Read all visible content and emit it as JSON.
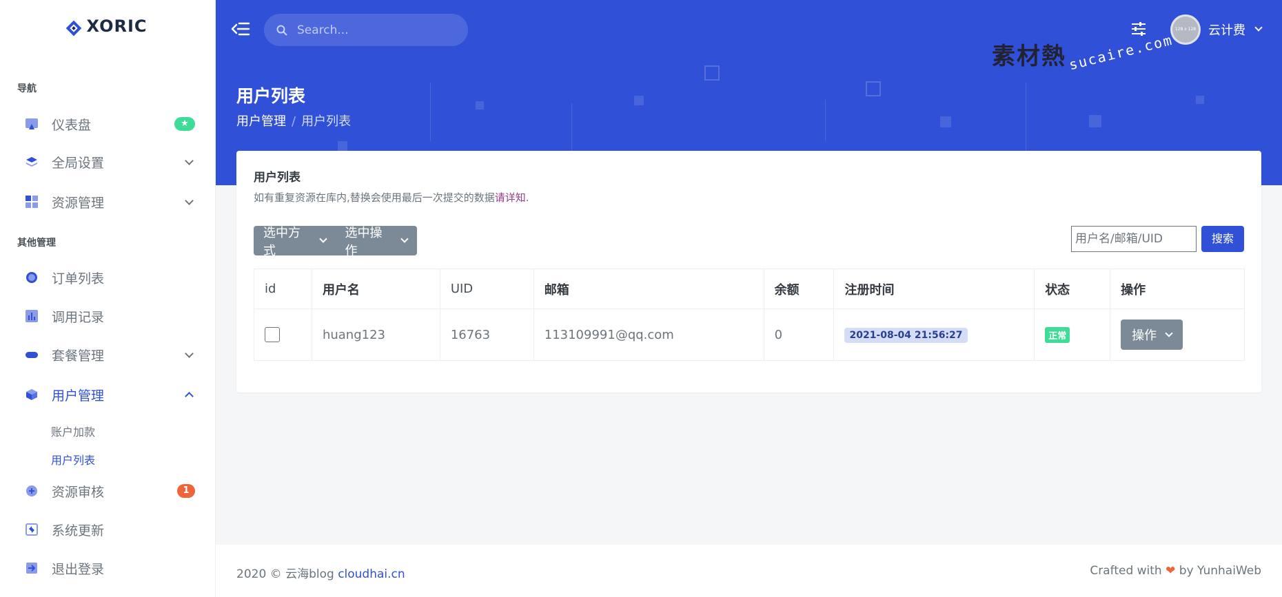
{
  "brand": {
    "name": "XORIC"
  },
  "sidebar": {
    "sections": [
      {
        "title": "导航"
      },
      {
        "title": "其他管理"
      }
    ],
    "items": [
      {
        "label": "仪表盘",
        "badge": "★"
      },
      {
        "label": "全局设置"
      },
      {
        "label": "资源管理"
      },
      {
        "label": "订单列表"
      },
      {
        "label": "调用记录"
      },
      {
        "label": "套餐管理"
      },
      {
        "label": "用户管理",
        "active": true
      },
      {
        "label": "资源审核",
        "badge": "1"
      },
      {
        "label": "系统更新"
      },
      {
        "label": "退出登录"
      }
    ],
    "sub_items": [
      {
        "label": "账户加款"
      },
      {
        "label": "用户列表",
        "active": true
      }
    ]
  },
  "header": {
    "search_placeholder": "Search...",
    "user_name": "云计费",
    "avatar_text": "128 x 128",
    "watermark_cn": "素材熱",
    "watermark_en": "sucaire.com",
    "page_title": "用户列表",
    "breadcrumb": [
      "用户管理",
      "用户列表"
    ],
    "breadcrumb_sep": "/"
  },
  "card": {
    "title": "用户列表",
    "desc": "如有重复资源在库内,替换会使用最后一次提交的数据",
    "desc_link": "请详知",
    "desc_end": ".",
    "select_mode_label": "选中方式",
    "select_action_label": "选中操作",
    "filter_placeholder": "用户名/邮箱/UID",
    "search_label": "搜索"
  },
  "table": {
    "columns": [
      "id",
      "用户名",
      "UID",
      "邮箱",
      "余额",
      "注册时间",
      "状态",
      "操作"
    ],
    "rows": [
      {
        "username": "huang123",
        "uid": "16763",
        "email": "113109991@qq.com",
        "balance": "0",
        "reg_time": "2021-08-04 21:56:27",
        "status": "正常",
        "action_label": "操作"
      }
    ]
  },
  "footer": {
    "left_text": "2020 © 云海blog ",
    "left_link": "cloudhai.cn",
    "right_prefix": "Crafted with ",
    "right_heart": "❤",
    "right_suffix": " by YunhaiWeb"
  },
  "colors": {
    "primary": "#3050d8",
    "success": "#3ddc97",
    "danger": "#f0643c",
    "secondary": "#7c8a98"
  }
}
